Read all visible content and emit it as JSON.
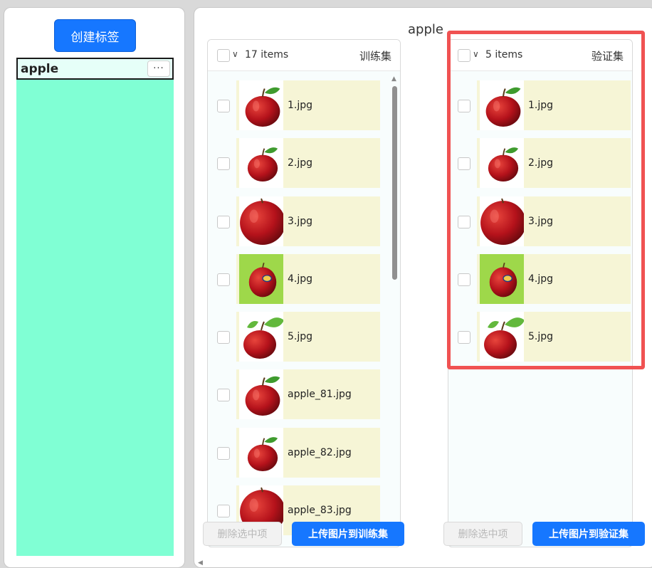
{
  "sidebar": {
    "create_label": "创建标签",
    "tags": [
      {
        "label": "apple",
        "menu": "···"
      }
    ]
  },
  "main": {
    "class_title": "apple",
    "train": {
      "count": "17 items",
      "name": "训练集",
      "items": [
        "1.jpg",
        "2.jpg",
        "3.jpg",
        "4.jpg",
        "5.jpg",
        "apple_81.jpg",
        "apple_82.jpg",
        "apple_83.jpg"
      ],
      "delete_label": "删除选中项",
      "upload_label": "上传图片到训练集"
    },
    "val": {
      "count": "5 items",
      "name": "验证集",
      "items": [
        "1.jpg",
        "2.jpg",
        "3.jpg",
        "4.jpg",
        "5.jpg"
      ],
      "delete_label": "删除选中项",
      "upload_label": "上传图片到验证集"
    }
  },
  "icons": {
    "chevron": "chevron-down-icon",
    "scroll_up": "scroll-up-icon",
    "scroll_down": "scroll-down-icon"
  },
  "colors": {
    "primary": "#1677ff",
    "tag_area": "#80ffd4",
    "filename_bg": "#f6f5d6",
    "highlight": "#f05252"
  }
}
